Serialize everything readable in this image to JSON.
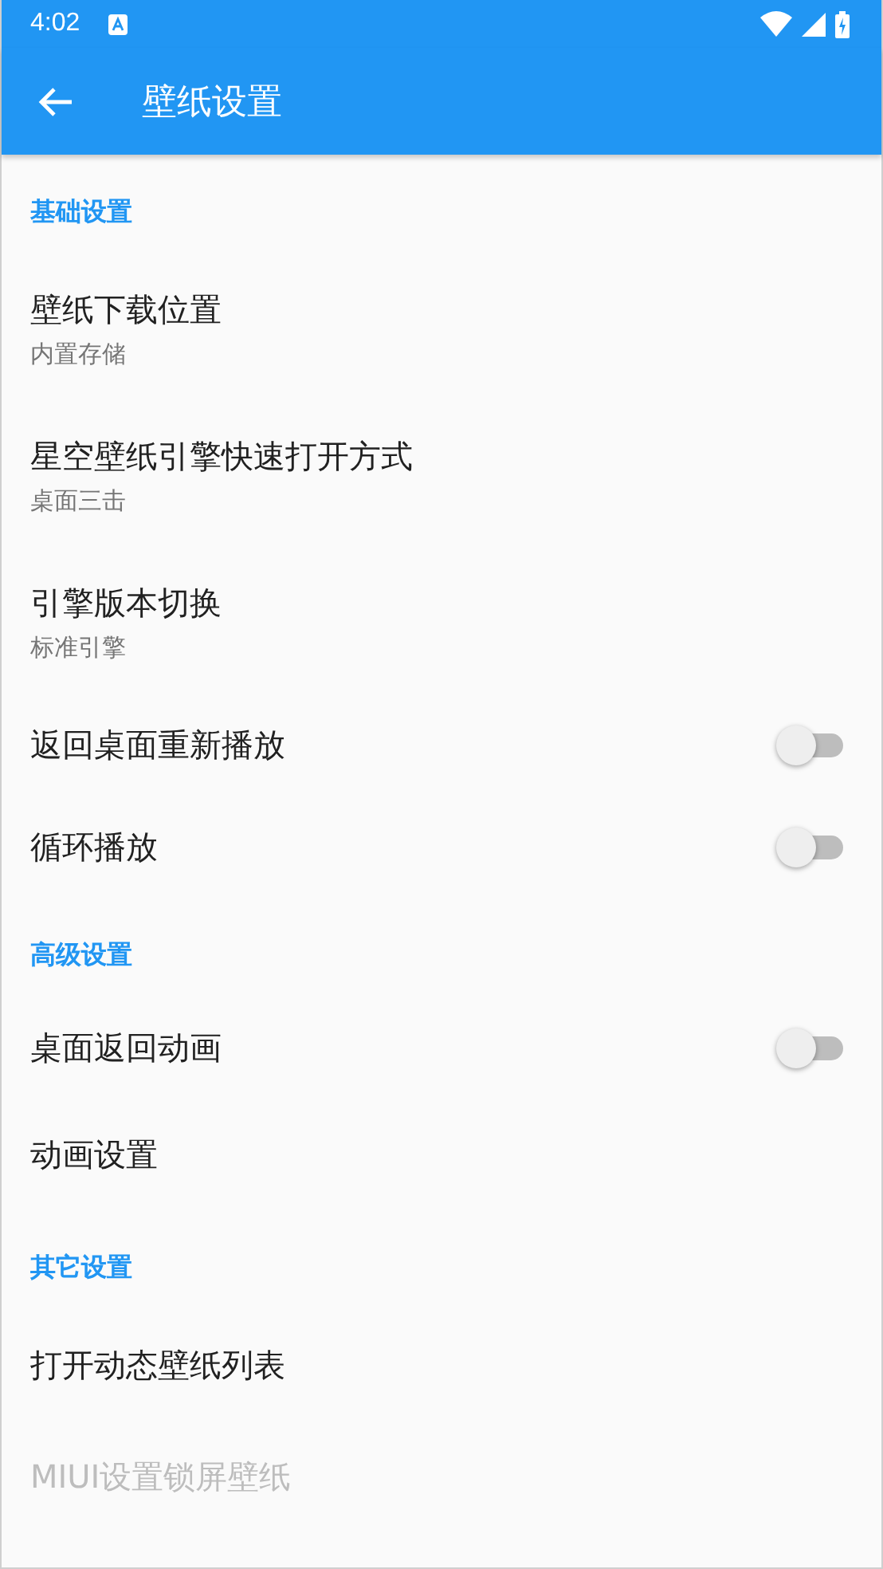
{
  "status_bar": {
    "time": "4:02"
  },
  "toolbar": {
    "title": "壁纸设置"
  },
  "sections": [
    {
      "header": "基础设置",
      "items": [
        {
          "kind": "text",
          "title": "壁纸下载位置",
          "summary": "内置存储",
          "disabled": false
        },
        {
          "kind": "text",
          "title": "星空壁纸引擎快速打开方式",
          "summary": "桌面三击",
          "disabled": false
        },
        {
          "kind": "text",
          "title": "引擎版本切换",
          "summary": "标准引擎",
          "disabled": false
        },
        {
          "kind": "switch",
          "title": "返回桌面重新播放",
          "on": false,
          "disabled": false
        },
        {
          "kind": "switch",
          "title": "循环播放",
          "on": false,
          "disabled": false
        }
      ]
    },
    {
      "header": "高级设置",
      "items": [
        {
          "kind": "switch",
          "title": "桌面返回动画",
          "on": false,
          "disabled": false
        },
        {
          "kind": "text",
          "title": "动画设置",
          "disabled": false
        }
      ]
    },
    {
      "header": "其它设置",
      "items": [
        {
          "kind": "text",
          "title": "打开动态壁纸列表",
          "disabled": false
        },
        {
          "kind": "text",
          "title": "MIUI设置锁屏壁纸",
          "disabled": true
        }
      ]
    }
  ]
}
